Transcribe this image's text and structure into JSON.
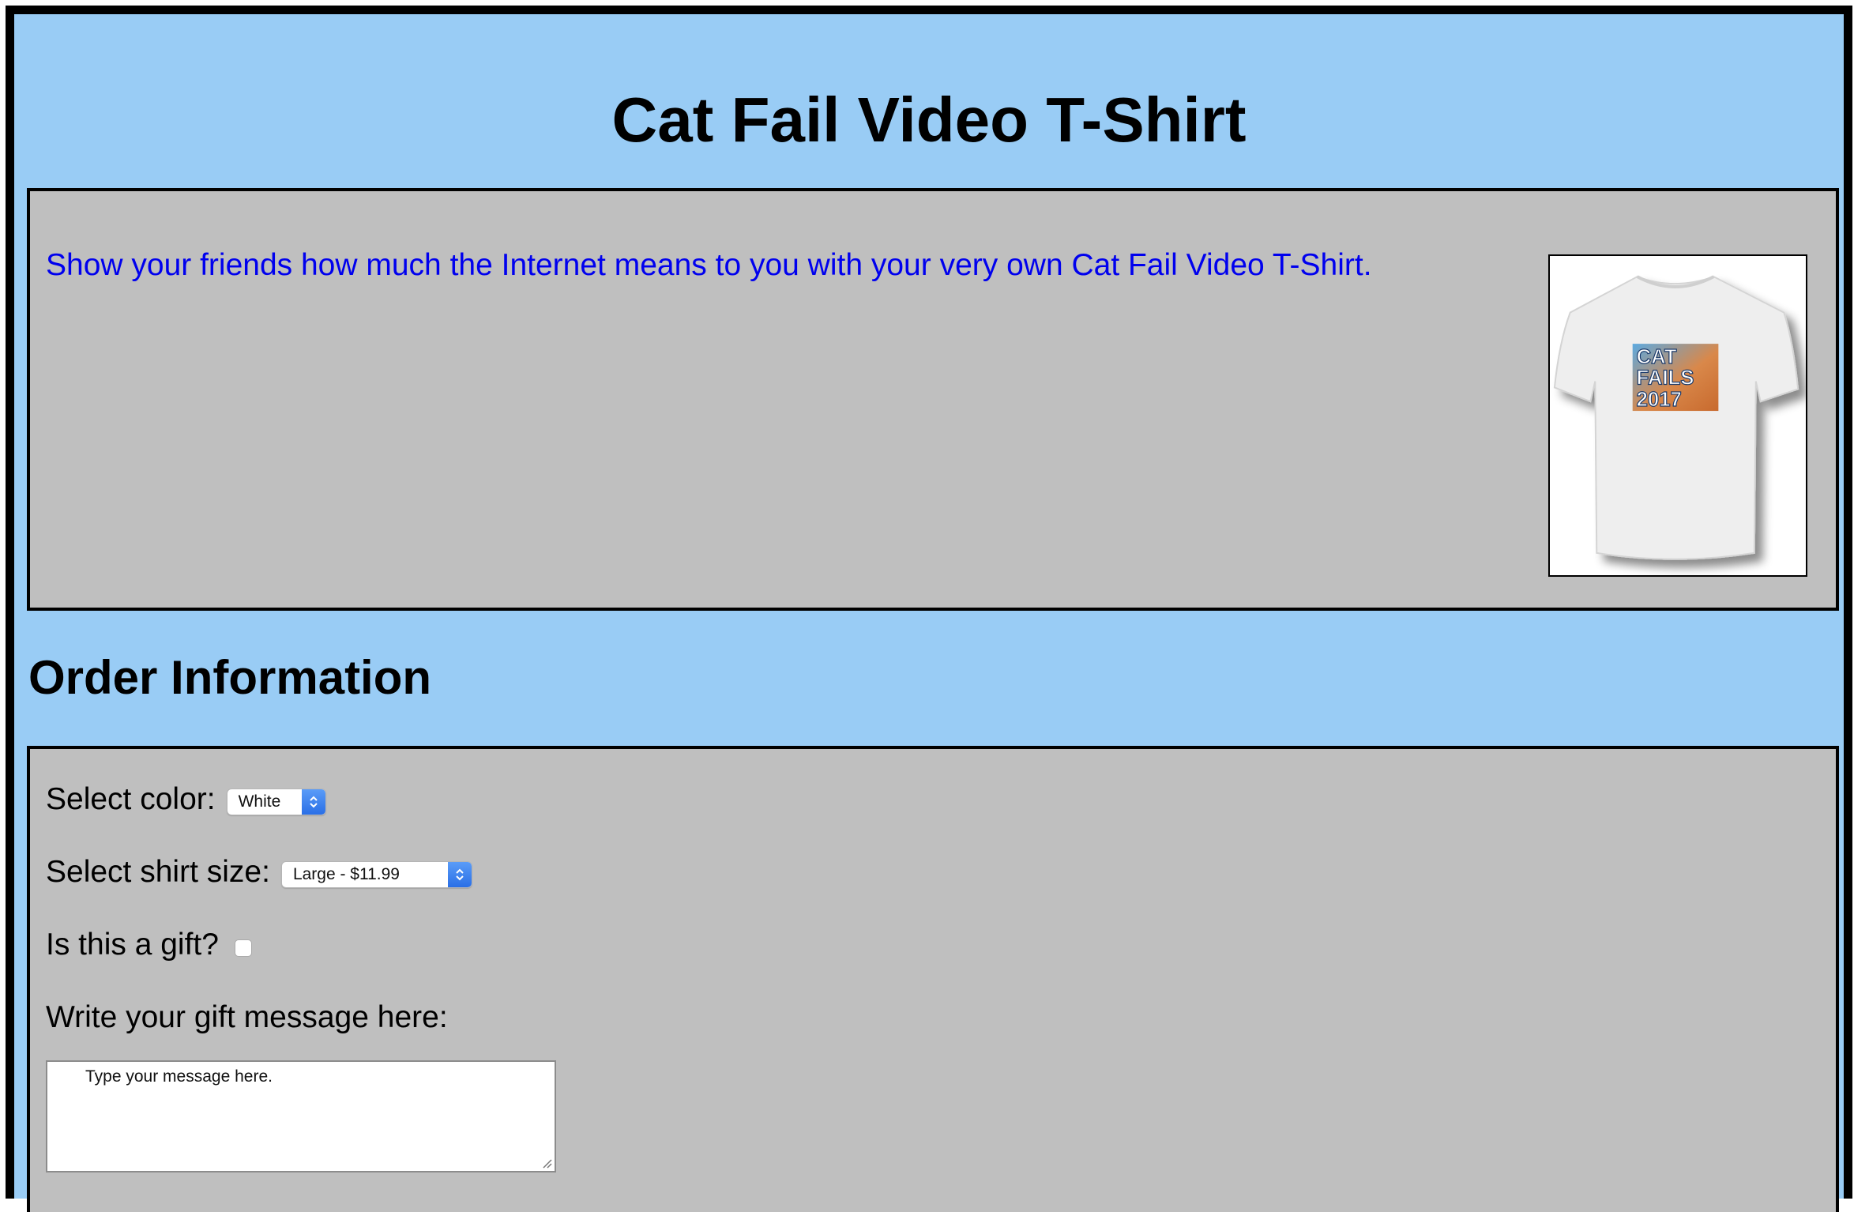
{
  "page": {
    "title": "Cat Fail Video T-Shirt",
    "description": "Show your friends how much the Internet means to you with your very own Cat Fail Video T-Shirt.",
    "product_image": {
      "shirt_print_lines": [
        "CAT",
        "FAILS",
        "2017"
      ]
    }
  },
  "order": {
    "heading": "Order Information",
    "color_label": "Select color:",
    "color_value": "White",
    "size_label": "Select shirt size:",
    "size_value": "Large - $11.99",
    "gift_label": "Is this a gift?",
    "gift_checked": false,
    "message_label": "Write your gift message here:",
    "message_value": "Type your message here."
  },
  "colors": {
    "background": "#99ccf5",
    "panel": "#bfbfbf",
    "link_text": "#0000ee",
    "select_accent": "#3b82f6"
  }
}
